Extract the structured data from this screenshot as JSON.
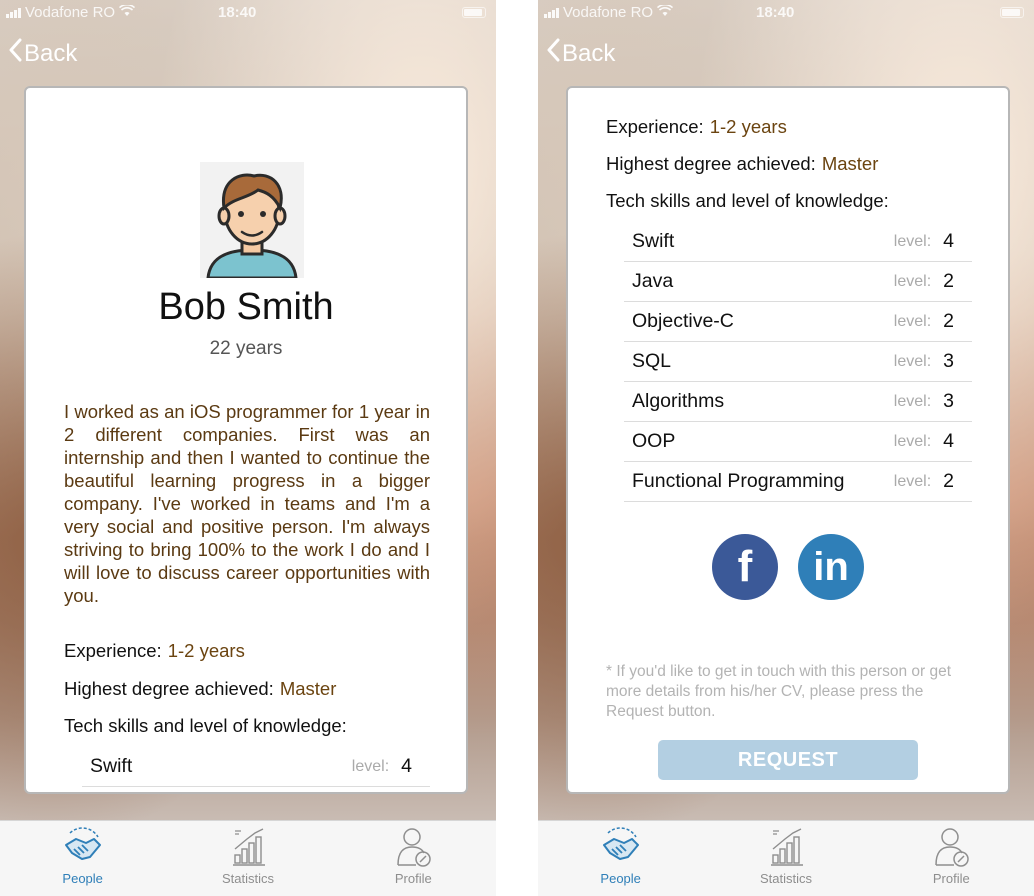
{
  "status_bar": {
    "carrier": "Vodafone RO",
    "time": "18:40"
  },
  "nav": {
    "back_label": "Back"
  },
  "profile": {
    "name": "Bob Smith",
    "age": "22 years",
    "bio": "I worked as an iOS programmer for 1 year in 2 different companies. First was an internship and then I wanted to continue the beautiful learning progress in a bigger company. I've worked in teams and I'm a very social and positive person. I'm always striving to bring 100% to the work I do and I will love to discuss career opportunities with you.",
    "experience_label": "Experience:",
    "experience_value": "1-2 years",
    "degree_label": "Highest degree achieved:",
    "degree_value": "Master",
    "skills_heading": "Tech skills and level of knowledge:",
    "level_label": "level:",
    "skills": [
      {
        "name": "Swift",
        "level": "4"
      },
      {
        "name": "Java",
        "level": "2"
      },
      {
        "name": "Objective-C",
        "level": "2"
      },
      {
        "name": "SQL",
        "level": "3"
      },
      {
        "name": "Algorithms",
        "level": "3"
      },
      {
        "name": "OOP",
        "level": "4"
      },
      {
        "name": "Functional Programming",
        "level": "2"
      }
    ]
  },
  "social": {
    "facebook_glyph": "f",
    "linkedin_glyph": "in"
  },
  "request_note": "* If you'd like to get in touch with this person or get more details from his/her CV, please press the Request button.",
  "request_button": "REQUEST",
  "tabs": [
    {
      "label": "People",
      "icon": "handshake-icon",
      "active": true
    },
    {
      "label": "Statistics",
      "icon": "bar-chart-icon",
      "active": false
    },
    {
      "label": "Profile",
      "icon": "user-edit-icon",
      "active": false
    }
  ],
  "colors": {
    "accent": "#2f7fb8",
    "detail_text": "#6b4410",
    "facebook": "#3b5998",
    "linkedin": "#2f7fb8",
    "request_button": "#b3cfe2"
  }
}
